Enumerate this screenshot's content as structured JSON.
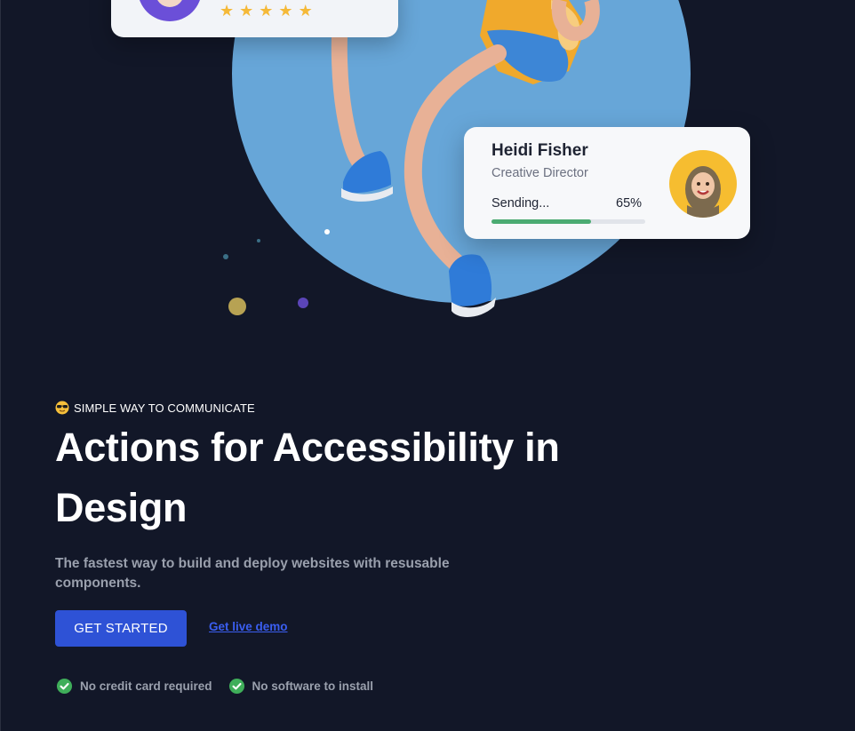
{
  "review_card": {
    "stars_icons": [
      "star-icon",
      "star-icon",
      "star-icon",
      "star-icon",
      "star-icon"
    ],
    "star_glyph": "★"
  },
  "profile_card": {
    "name": "Heidi Fisher",
    "role": "Creative Director",
    "status_label": "Sending...",
    "progress_label": "65%",
    "progress": 0.65
  },
  "hero": {
    "eyebrow_icon": "sunglasses-emoji-icon",
    "eyebrow": "SIMPLE WAY TO COMMUNICATE",
    "headline": "Actions for Accessibility in Design",
    "subtitle": "The fastest way to build and deploy websites with resusable components."
  },
  "actions": {
    "primary_label": "GET STARTED",
    "secondary_label": "Get live demo"
  },
  "features": [
    {
      "icon": "check-circle-icon",
      "label": "No credit card required"
    },
    {
      "icon": "check-circle-icon",
      "label": "No software to install"
    }
  ],
  "colors": {
    "background": "#121728",
    "accent": "#2e52d6",
    "link": "#3a5ef0",
    "circle": "#67a6d8",
    "progress": "#4bab72",
    "star": "#f5b938"
  }
}
